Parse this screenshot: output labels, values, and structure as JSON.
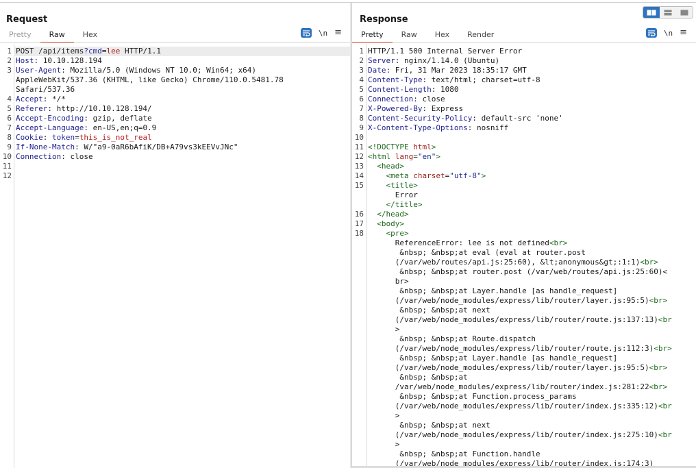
{
  "layout_buttons": [
    {
      "icon": "split-vertical-icon",
      "active": true
    },
    {
      "icon": "split-horizontal-icon",
      "active": false
    },
    {
      "icon": "single-pane-icon",
      "active": false
    }
  ],
  "request": {
    "title": "Request",
    "tabs": [
      "Pretty",
      "Raw",
      "Hex"
    ],
    "active_tab": "Raw",
    "tools": {
      "wrap_icon": "word-wrap-icon",
      "newline_label": "\\n",
      "menu_icon": "hamburger-menu-icon"
    },
    "lines": [
      {
        "n": "1",
        "t": "POST /api/items?cmd=lee HTTP/1.1"
      },
      {
        "n": "2",
        "k": "Host",
        "v": " 10.10.128.194"
      },
      {
        "n": "3",
        "k": "User-Agent",
        "v": " Mozilla/5.0 (Windows NT 10.0; Win64; x64)"
      },
      {
        "n": "",
        "t": "AppleWebKit/537.36 (KHTML, like Gecko) Chrome/110.0.5481.78"
      },
      {
        "n": "",
        "t": "Safari/537.36"
      },
      {
        "n": "4",
        "k": "Accept",
        "v": " */*"
      },
      {
        "n": "5",
        "k": "Referer",
        "v": " http://10.10.128.194/"
      },
      {
        "n": "6",
        "k": "Accept-Encoding",
        "v": " gzip, deflate"
      },
      {
        "n": "7",
        "k": "Accept-Language",
        "v": " en-US,en;q=0.9"
      },
      {
        "n": "8",
        "k": "Cookie",
        "v": " token=this_is_not_real"
      },
      {
        "n": "9",
        "k": "If-None-Match",
        "v": " W/\"a9-0aR6bAfiK/DB+A79vs3kEEVvJNc\""
      },
      {
        "n": "10",
        "k": "Connection",
        "v": " close"
      },
      {
        "n": "11",
        "t": ""
      },
      {
        "n": "12",
        "t": ""
      }
    ]
  },
  "response": {
    "title": "Response",
    "tabs": [
      "Pretty",
      "Raw",
      "Hex",
      "Render"
    ],
    "active_tab": "Pretty",
    "tools": {
      "wrap_icon": "word-wrap-icon",
      "newline_label": "\\n",
      "menu_icon": "hamburger-menu-icon"
    },
    "lines": [
      {
        "n": "1",
        "t": "HTTP/1.1 500 Internal Server Error"
      },
      {
        "n": "2",
        "k": "Server",
        "v": " nginx/1.14.0 (Ubuntu)"
      },
      {
        "n": "3",
        "k": "Date",
        "v": " Fri, 31 Mar 2023 18:35:17 GMT"
      },
      {
        "n": "4",
        "k": "Content-Type",
        "v": " text/html; charset=utf-8"
      },
      {
        "n": "5",
        "k": "Content-Length",
        "v": " 1080"
      },
      {
        "n": "6",
        "k": "Connection",
        "v": " close"
      },
      {
        "n": "7",
        "k": "X-Powered-By",
        "v": " Express"
      },
      {
        "n": "8",
        "k": "Content-Security-Policy",
        "v": " default-src 'none'"
      },
      {
        "n": "9",
        "k": "X-Content-Type-Options",
        "v": " nosniff"
      },
      {
        "n": "10",
        "t": ""
      },
      {
        "n": "11",
        "html": "<!DOCTYPE html>"
      },
      {
        "n": "12",
        "html": "<html lang=\"en\">"
      },
      {
        "n": "13",
        "html": "  <head>"
      },
      {
        "n": "14",
        "html": "    <meta charset=\"utf-8\">"
      },
      {
        "n": "15",
        "html": "    <title>"
      },
      {
        "n": "",
        "t": "      Error"
      },
      {
        "n": "",
        "html": "    </title>"
      },
      {
        "n": "16",
        "html": "  </head>"
      },
      {
        "n": "17",
        "html": "  <body>"
      },
      {
        "n": "18",
        "html": "    <pre>"
      },
      {
        "n": "",
        "html": "      ReferenceError: lee is not defined<br>"
      },
      {
        "n": "",
        "t": "       &nbsp; &nbsp;at eval (eval at router.post"
      },
      {
        "n": "",
        "html": "      (/var/web/routes/api.js:25:60), &lt;anonymous&gt;:1:1)<br>"
      },
      {
        "n": "",
        "t": "       &nbsp; &nbsp;at router.post (/var/web/routes/api.js:25:60)<"
      },
      {
        "n": "",
        "html": "      br>"
      },
      {
        "n": "",
        "t": "       &nbsp; &nbsp;at Layer.handle [as handle_request]"
      },
      {
        "n": "",
        "html": "      (/var/web/node_modules/express/lib/router/layer.js:95:5)<br>"
      },
      {
        "n": "",
        "t": "       &nbsp; &nbsp;at next"
      },
      {
        "n": "",
        "html": "      (/var/web/node_modules/express/lib/router/route.js:137:13)<br"
      },
      {
        "n": "",
        "t": "      >"
      },
      {
        "n": "",
        "t": "       &nbsp; &nbsp;at Route.dispatch"
      },
      {
        "n": "",
        "html": "      (/var/web/node_modules/express/lib/router/route.js:112:3)<br>"
      },
      {
        "n": "",
        "t": "       &nbsp; &nbsp;at Layer.handle [as handle_request]"
      },
      {
        "n": "",
        "html": "      (/var/web/node_modules/express/lib/router/layer.js:95:5)<br>"
      },
      {
        "n": "",
        "t": "       &nbsp; &nbsp;at"
      },
      {
        "n": "",
        "html": "      /var/web/node_modules/express/lib/router/index.js:281:22<br>"
      },
      {
        "n": "",
        "t": "       &nbsp; &nbsp;at Function.process_params"
      },
      {
        "n": "",
        "html": "      (/var/web/node_modules/express/lib/router/index.js:335:12)<br"
      },
      {
        "n": "",
        "t": "      >"
      },
      {
        "n": "",
        "t": "       &nbsp; &nbsp;at next"
      },
      {
        "n": "",
        "html": "      (/var/web/node_modules/express/lib/router/index.js:275:10)<br"
      },
      {
        "n": "",
        "t": "      >"
      },
      {
        "n": "",
        "t": "       &nbsp; &nbsp;at Function.handle"
      },
      {
        "n": "",
        "t": "      (/var/web/node_modules/express/lib/router/index.js:174:3)"
      }
    ]
  }
}
